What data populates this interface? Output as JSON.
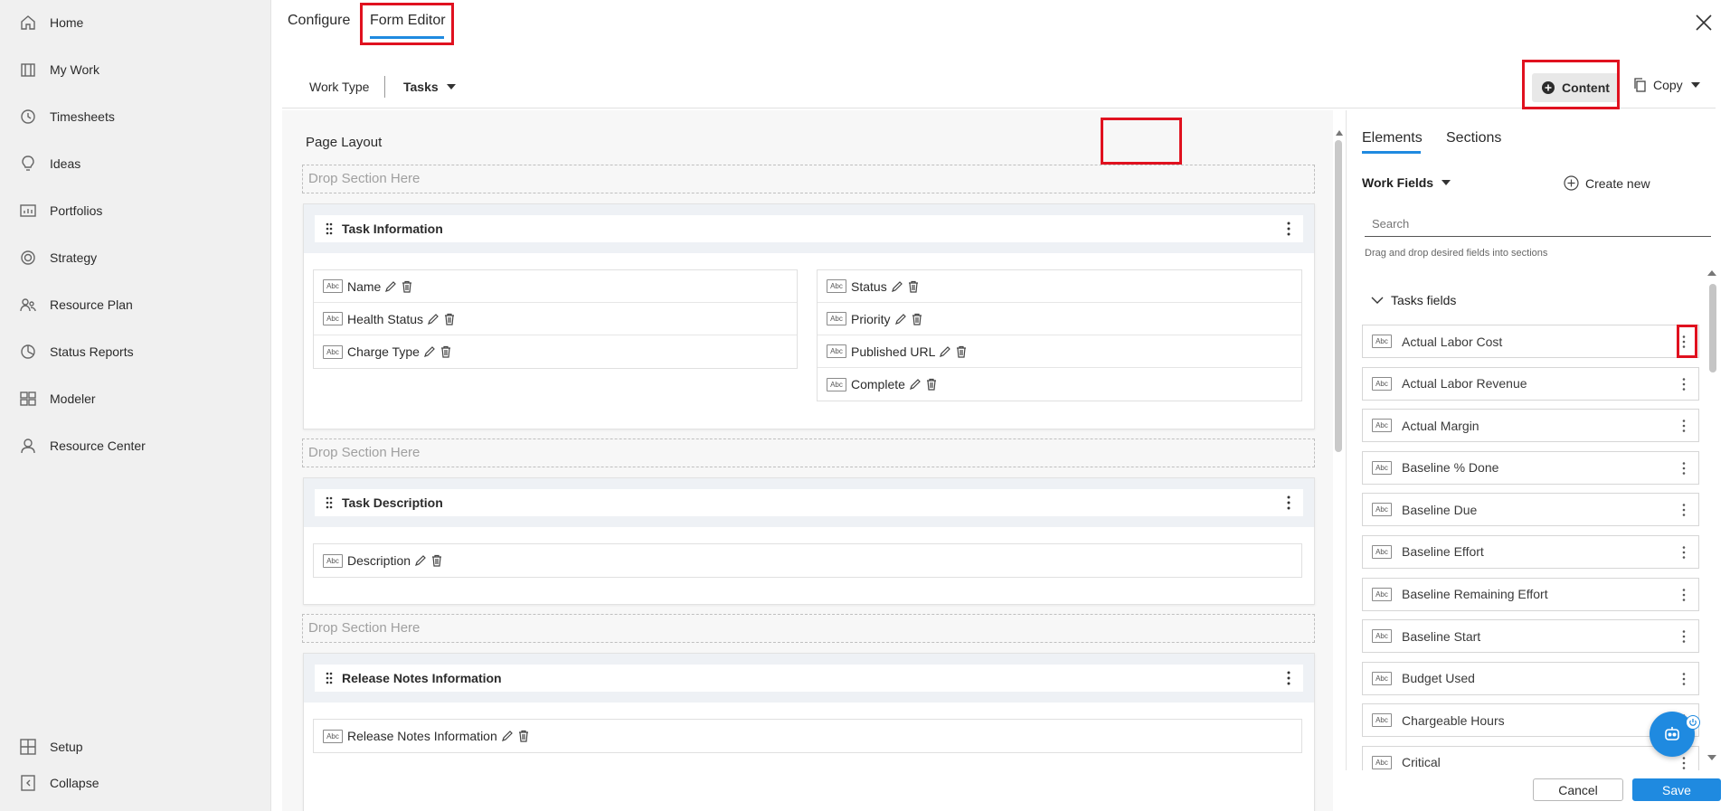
{
  "nav": {
    "items": [
      {
        "label": "Home",
        "icon": "home-icon"
      },
      {
        "label": "My Work",
        "icon": "briefcase-icon"
      },
      {
        "label": "Timesheets",
        "icon": "clock-icon"
      },
      {
        "label": "Ideas",
        "icon": "lightbulb-icon"
      },
      {
        "label": "Portfolios",
        "icon": "chart-icon"
      },
      {
        "label": "Strategy",
        "icon": "target-icon"
      },
      {
        "label": "Resource Plan",
        "icon": "people-icon"
      },
      {
        "label": "Status Reports",
        "icon": "report-icon"
      },
      {
        "label": "Modeler",
        "icon": "modeler-icon"
      },
      {
        "label": "Resource Center",
        "icon": "person-icon"
      }
    ],
    "setup": "Setup",
    "collapse": "Collapse"
  },
  "header": {
    "tab_configure": "Configure",
    "tab_form_editor": "Form Editor",
    "work_type_label": "Work Type",
    "work_type_value": "Tasks",
    "content_button": "Content",
    "copy_button": "Copy"
  },
  "canvas": {
    "title": "Page Layout",
    "drop_zone": "Drop Section Here",
    "sections": [
      {
        "title": "Task Information",
        "left_fields": [
          "Name",
          "Health Status",
          "Charge Type"
        ],
        "right_fields": [
          "Status",
          "Priority",
          "Published URL",
          "Complete"
        ]
      },
      {
        "title": "Task Description",
        "fields": [
          "Description"
        ]
      },
      {
        "title": "Release Notes Information",
        "fields": [
          "Release Notes Information"
        ]
      }
    ]
  },
  "panel": {
    "tab_elements": "Elements",
    "tab_sections": "Sections",
    "fields_dropdown": "Work Fields",
    "create_new": "Create new",
    "search_placeholder": "Search",
    "hint": "Drag and drop desired fields into sections",
    "group_title": "Tasks fields",
    "elements": [
      "Actual Labor Cost",
      "Actual Labor Revenue",
      "Actual Margin",
      "Baseline % Done",
      "Baseline Due",
      "Baseline Effort",
      "Baseline Remaining Effort",
      "Baseline Start",
      "Budget Used",
      "Chargeable Hours",
      "Critical"
    ]
  },
  "footer": {
    "cancel": "Cancel",
    "save": "Save"
  },
  "colors": {
    "accent": "#1f8ae0",
    "highlight": "#e0111f",
    "nav_bg": "#f0f0f0"
  },
  "icon_text": "Abc"
}
